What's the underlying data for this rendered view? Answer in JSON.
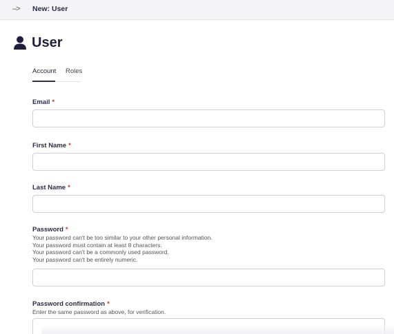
{
  "breadcrumb": {
    "arrow": "–>",
    "current": "New: User"
  },
  "header": {
    "icon": "user-icon",
    "title": "User"
  },
  "tabs": [
    {
      "label": "Account",
      "active": true
    },
    {
      "label": "Roles",
      "active": false
    }
  ],
  "form": {
    "email": {
      "label": "Email",
      "required_mark": "*",
      "value": ""
    },
    "first_name": {
      "label": "First Name",
      "required_mark": "*",
      "value": ""
    },
    "last_name": {
      "label": "Last Name",
      "required_mark": "*",
      "value": ""
    },
    "password": {
      "label": "Password",
      "required_mark": "*",
      "value": "",
      "help": [
        "Your password can't be too similar to your other personal information.",
        "Your password must contain at least 8 characters.",
        "Your password can't be a commonly used password.",
        "Your password can't be entirely numeric."
      ]
    },
    "password_confirmation": {
      "label": "Password confirmation",
      "required_mark": "*",
      "value": "",
      "help": "Enter the same password as above, for verification."
    }
  },
  "colors": {
    "accent": "#2d2a5e",
    "required": "#c0392b"
  }
}
